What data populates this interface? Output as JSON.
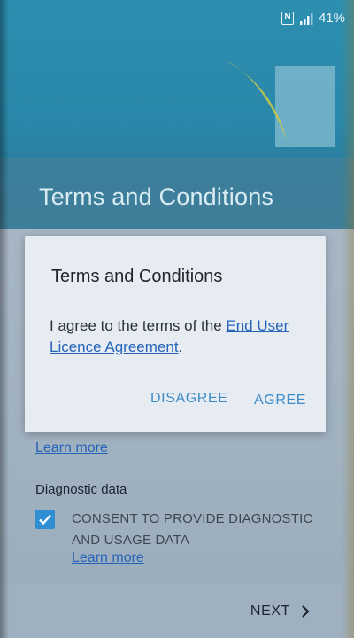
{
  "status_bar": {
    "nfc_label": "N",
    "battery_percent": "41%",
    "icons": [
      "nfc-icon",
      "signal-icon"
    ]
  },
  "header": {
    "title": "Terms and Conditions"
  },
  "content": {
    "learn_more_1": "Learn more",
    "diagnostic_heading": "Diagnostic data",
    "consent_label": "CONSENT TO PROVIDE DIAGNOSTIC AND USAGE DATA",
    "consent_checked": true,
    "learn_more_2": "Learn more"
  },
  "bottom_bar": {
    "next_label": "NEXT",
    "next_icon": "chevron-right-icon"
  },
  "dialog": {
    "title": "Terms and Conditions",
    "body_prefix": "I agree to the terms of the ",
    "body_link": "End User Licence Agreement",
    "body_suffix": ".",
    "disagree_label": "DISAGREE",
    "agree_label": "AGREE"
  },
  "colors": {
    "header_bg": "#2d8fb0",
    "link": "#2563b8",
    "dialog_action": "#3d8cc8",
    "checkbox": "#2f8fd2"
  }
}
